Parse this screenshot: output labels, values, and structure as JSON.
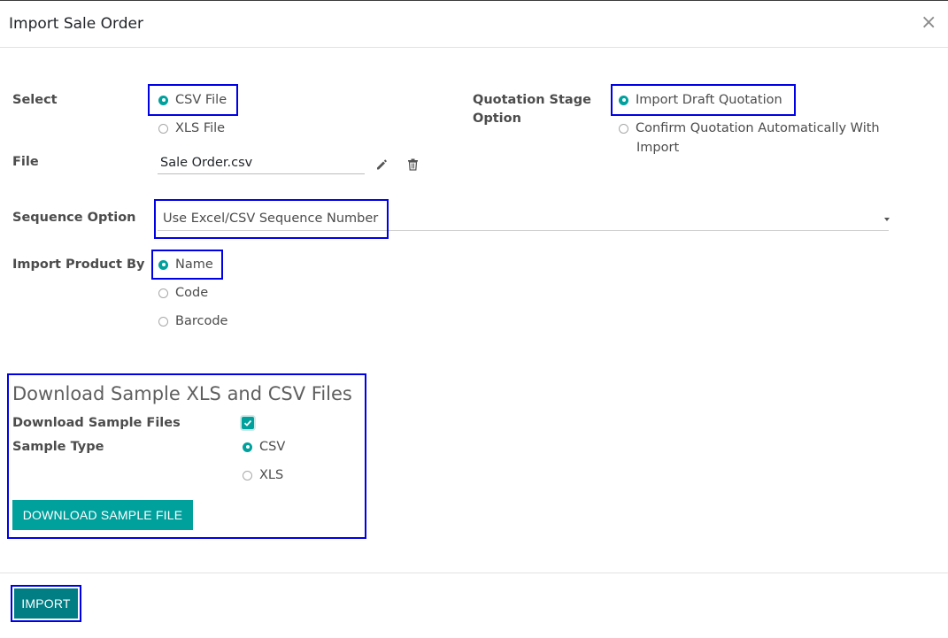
{
  "dialog": {
    "title": "Import Sale Order",
    "close_glyph": "×"
  },
  "select": {
    "label": "Select",
    "options": [
      {
        "label": "CSV File",
        "checked": true
      },
      {
        "label": "XLS File",
        "checked": false
      }
    ]
  },
  "quotation_stage": {
    "label_line1": "Quotation Stage",
    "label_line2": "Option",
    "options": [
      {
        "label": "Import Draft Quotation",
        "checked": true
      },
      {
        "label_line1": "Confirm Quotation Automatically With",
        "label_line2": "Import",
        "checked": false
      }
    ]
  },
  "file": {
    "label": "File",
    "value": "Sale Order.csv"
  },
  "sequence": {
    "label": "Sequence Option",
    "value": "Use Excel/CSV Sequence Number"
  },
  "import_product_by": {
    "label": "Import Product By",
    "options": [
      {
        "label": "Name",
        "checked": true
      },
      {
        "label": "Code",
        "checked": false
      },
      {
        "label": "Barcode",
        "checked": false
      }
    ]
  },
  "sample": {
    "title": "Download Sample XLS and CSV Files",
    "download_label": "Download Sample Files",
    "download_checked": true,
    "type_label": "Sample Type",
    "type_options": [
      {
        "label": "CSV",
        "checked": true
      },
      {
        "label": "XLS",
        "checked": false
      }
    ],
    "button_label": "DOWNLOAD SAMPLE FILE"
  },
  "footer": {
    "import_label": "IMPORT"
  },
  "colors": {
    "primary": "#00a09d",
    "import": "#017e84",
    "highlight": "#0000e6"
  }
}
